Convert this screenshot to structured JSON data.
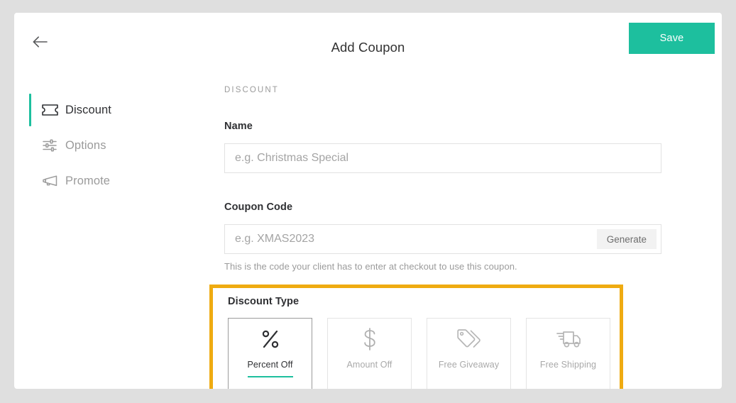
{
  "header": {
    "back_icon": "arrow-left-icon",
    "title": "Add Coupon",
    "save_label": "Save",
    "save_color": "#1dbf9e"
  },
  "sidebar": {
    "items": [
      {
        "label": "Discount",
        "icon": "ticket-icon",
        "active": true
      },
      {
        "label": "Options",
        "icon": "sliders-icon",
        "active": false
      },
      {
        "label": "Promote",
        "icon": "megaphone-icon",
        "active": false
      }
    ],
    "active_indicator_color": "#1dbf9e"
  },
  "main": {
    "eyebrow": "DISCOUNT",
    "name_field": {
      "label": "Name",
      "value": "",
      "placeholder": "e.g. Christmas Special"
    },
    "coupon_code_field": {
      "label": "Coupon Code",
      "value": "",
      "placeholder": "e.g. XMAS2023",
      "generate_label": "Generate",
      "help_text": "This is the code your client has to enter at checkout to use this coupon."
    },
    "discount_type": {
      "label": "Discount Type",
      "highlight_color": "#efab11",
      "selected": "Percent Off",
      "options": [
        {
          "label": "Percent Off",
          "icon": "percent-icon",
          "selected": true
        },
        {
          "label": "Amount Off",
          "icon": "dollar-icon",
          "selected": false
        },
        {
          "label": "Free Giveaway",
          "icon": "tags-icon",
          "selected": false
        },
        {
          "label": "Free Shipping",
          "icon": "delivery-truck-icon",
          "selected": false
        }
      ]
    }
  }
}
